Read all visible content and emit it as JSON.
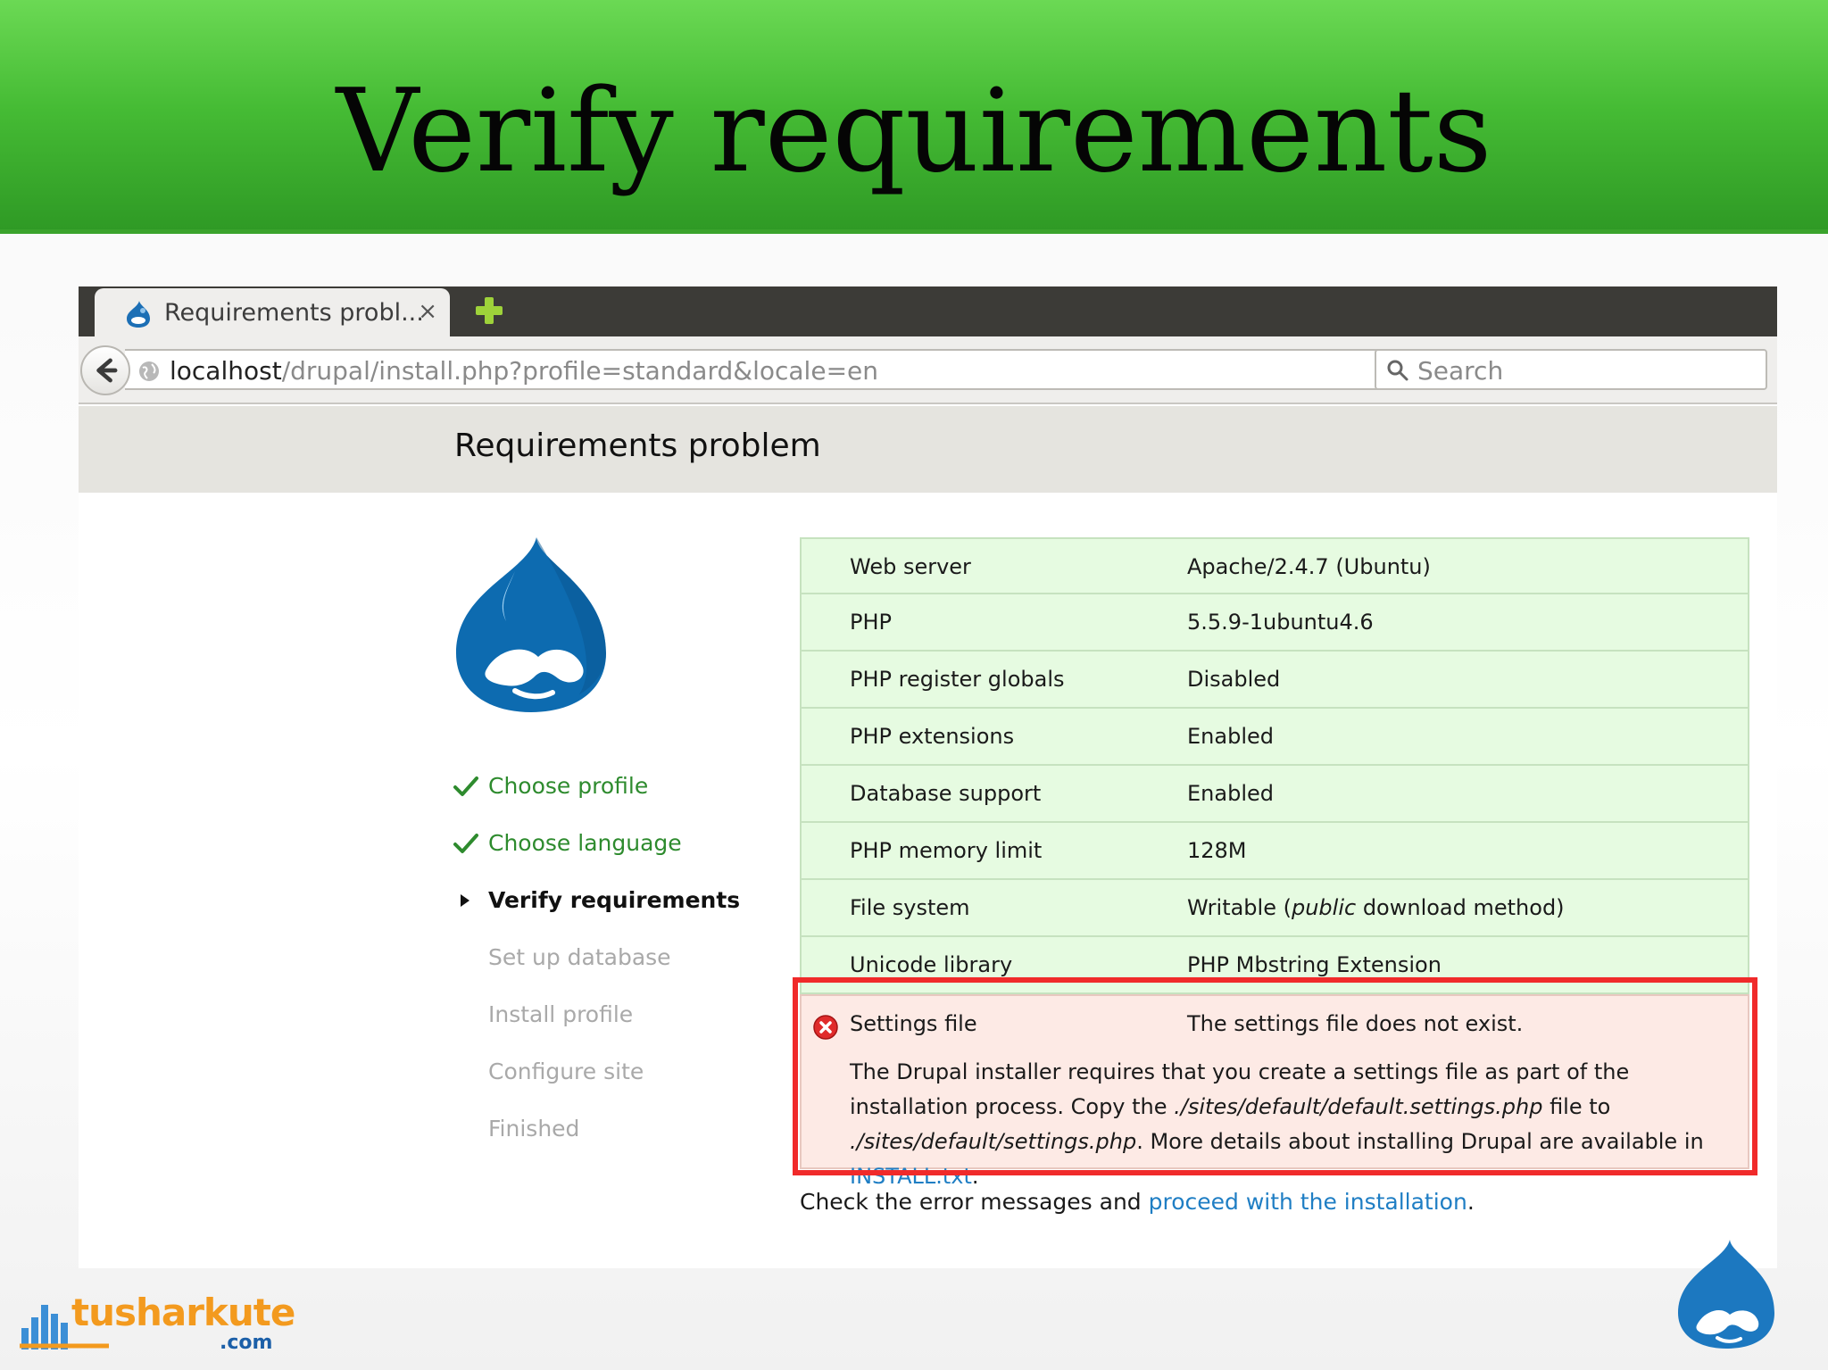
{
  "slide": {
    "title": "Verify requirements",
    "brand_name": "tusharkute",
    "brand_tld": ".com"
  },
  "browser": {
    "tab_title": "Requirements probl...",
    "tab_close": "×",
    "url_host": "localhost",
    "url_path": "/drupal/install.php?profile=standard&locale=en",
    "search_placeholder": "Search"
  },
  "page": {
    "title": "Requirements problem",
    "steps": [
      {
        "label": "Choose profile",
        "state": "done"
      },
      {
        "label": "Choose language",
        "state": "done"
      },
      {
        "label": "Verify requirements",
        "state": "active"
      },
      {
        "label": "Set up database",
        "state": "todo"
      },
      {
        "label": "Install profile",
        "state": "todo"
      },
      {
        "label": "Configure site",
        "state": "todo"
      },
      {
        "label": "Finished",
        "state": "todo"
      }
    ],
    "requirements": [
      {
        "name": "Web server",
        "value": "Apache/2.4.7 (Ubuntu)"
      },
      {
        "name": "PHP",
        "value": "5.5.9-1ubuntu4.6"
      },
      {
        "name": "PHP register globals",
        "value": "Disabled"
      },
      {
        "name": "PHP extensions",
        "value": "Enabled"
      },
      {
        "name": "Database support",
        "value": "Enabled"
      },
      {
        "name": "PHP memory limit",
        "value": "128M"
      },
      {
        "name": "File system",
        "value_pre": "Writable (",
        "value_em": "public",
        "value_post": " download method)"
      },
      {
        "name": "Unicode library",
        "value": "PHP Mbstring Extension"
      }
    ],
    "error": {
      "name": "Settings file",
      "value": "The settings file does not exist.",
      "desc_1": "The Drupal installer requires that you create a settings file as part of the installation process. Copy the ",
      "desc_em_1": "./sites/default/default.settings.php",
      "desc_2": " file to ",
      "desc_em_2": "./sites/default/settings.php",
      "desc_3": ". More details about installing Drupal are available in ",
      "desc_link": "INSTALL.txt",
      "desc_4": "."
    },
    "footer_text": "Check the error messages and ",
    "footer_link": "proceed with the installation",
    "footer_end": "."
  },
  "colors": {
    "header_green": "#45bb34",
    "ok_row": "#e6fbe1",
    "error_row": "#fdeae5",
    "highlight": "#f02a2a",
    "link": "#1f7ec4",
    "done_step": "#2e8b2e"
  }
}
